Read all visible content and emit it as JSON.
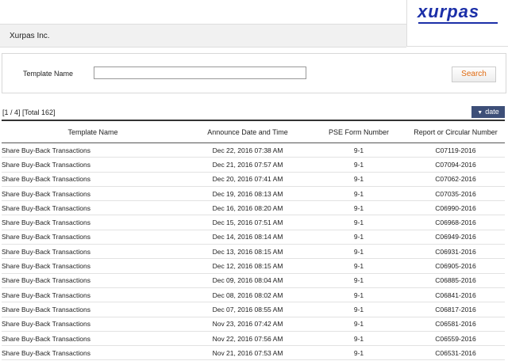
{
  "header": {
    "company_name": "Xurpas Inc.",
    "logo_text": "xurpas",
    "brand_color": "#1b2fa8"
  },
  "search": {
    "label": "Template Name",
    "input_value": "",
    "button_label": "Search"
  },
  "pager": {
    "text": "[1 / 4] [Total 162]"
  },
  "sort_button": {
    "label": "date",
    "icon": "arrow-down-icon"
  },
  "table": {
    "columns": [
      "Template Name",
      "Announce Date and Time",
      "PSE Form Number",
      "Report or Circular Number"
    ],
    "rows": [
      {
        "name": "Share Buy-Back Transactions",
        "date": "Dec 22, 2016 07:38 AM",
        "form": "9-1",
        "report": "C07119-2016"
      },
      {
        "name": "Share Buy-Back Transactions",
        "date": "Dec 21, 2016 07:57 AM",
        "form": "9-1",
        "report": "C07094-2016"
      },
      {
        "name": "Share Buy-Back Transactions",
        "date": "Dec 20, 2016 07:41 AM",
        "form": "9-1",
        "report": "C07062-2016"
      },
      {
        "name": "Share Buy-Back Transactions",
        "date": "Dec 19, 2016 08:13 AM",
        "form": "9-1",
        "report": "C07035-2016"
      },
      {
        "name": "Share Buy-Back Transactions",
        "date": "Dec 16, 2016 08:20 AM",
        "form": "9-1",
        "report": "C06990-2016"
      },
      {
        "name": "Share Buy-Back Transactions",
        "date": "Dec 15, 2016 07:51 AM",
        "form": "9-1",
        "report": "C06968-2016"
      },
      {
        "name": "Share Buy-Back Transactions",
        "date": "Dec 14, 2016 08:14 AM",
        "form": "9-1",
        "report": "C06949-2016"
      },
      {
        "name": "Share Buy-Back Transactions",
        "date": "Dec 13, 2016 08:15 AM",
        "form": "9-1",
        "report": "C06931-2016"
      },
      {
        "name": "Share Buy-Back Transactions",
        "date": "Dec 12, 2016 08:15 AM",
        "form": "9-1",
        "report": "C06905-2016"
      },
      {
        "name": "Share Buy-Back Transactions",
        "date": "Dec 09, 2016 08:04 AM",
        "form": "9-1",
        "report": "C06885-2016"
      },
      {
        "name": "Share Buy-Back Transactions",
        "date": "Dec 08, 2016 08:02 AM",
        "form": "9-1",
        "report": "C06841-2016"
      },
      {
        "name": "Share Buy-Back Transactions",
        "date": "Dec 07, 2016 08:55 AM",
        "form": "9-1",
        "report": "C06817-2016"
      },
      {
        "name": "Share Buy-Back Transactions",
        "date": "Nov 23, 2016 07:42 AM",
        "form": "9-1",
        "report": "C06581-2016"
      },
      {
        "name": "Share Buy-Back Transactions",
        "date": "Nov 22, 2016 07:56 AM",
        "form": "9-1",
        "report": "C06559-2016"
      },
      {
        "name": "Share Buy-Back Transactions",
        "date": "Nov 21, 2016 07:53 AM",
        "form": "9-1",
        "report": "C06531-2016"
      }
    ]
  }
}
